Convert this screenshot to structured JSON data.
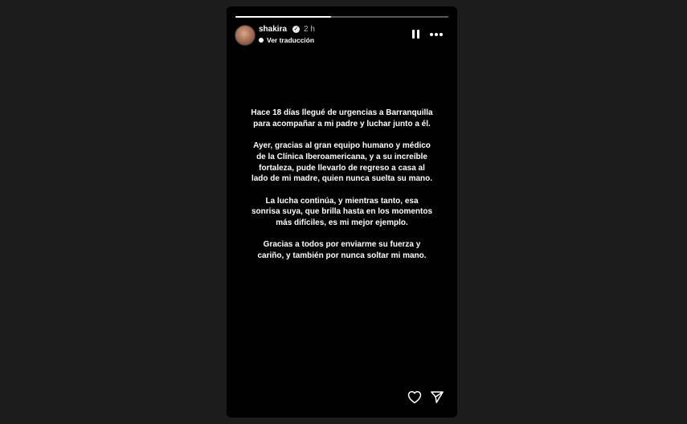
{
  "story": {
    "progress": 0.45,
    "user": {
      "username": "shakira",
      "verified_icon": "verified-badge-icon",
      "timestamp": "2 h",
      "translate_label": "Ver traducción"
    },
    "message_paragraphs": [
      "Hace 18 días llegué de urgencias a Barranquilla para acompañar a mi padre y luchar junto a él.",
      "Ayer, gracias al gran equipo humano y médico de la Clínica Iberoamericana, y a su increíble fortaleza, pude llevarlo de regreso a casa al lado de mi madre, quien nunca suelta su mano.",
      "La lucha continúa, y mientras tanto, esa sonrisa suya, que brilla hasta en los momentos más difíciles, es mi mejor ejemplo.",
      "Gracias a todos por enviarme su fuerza y cariño, y también por nunca soltar mi mano."
    ],
    "controls": {
      "pause_icon": "pause-icon",
      "more_icon": "more-options-icon",
      "like_icon": "heart-icon",
      "share_icon": "send-icon"
    }
  },
  "colors": {
    "story_background": "#000000",
    "page_background": "#1c1c1c",
    "text": "#ffffff"
  }
}
